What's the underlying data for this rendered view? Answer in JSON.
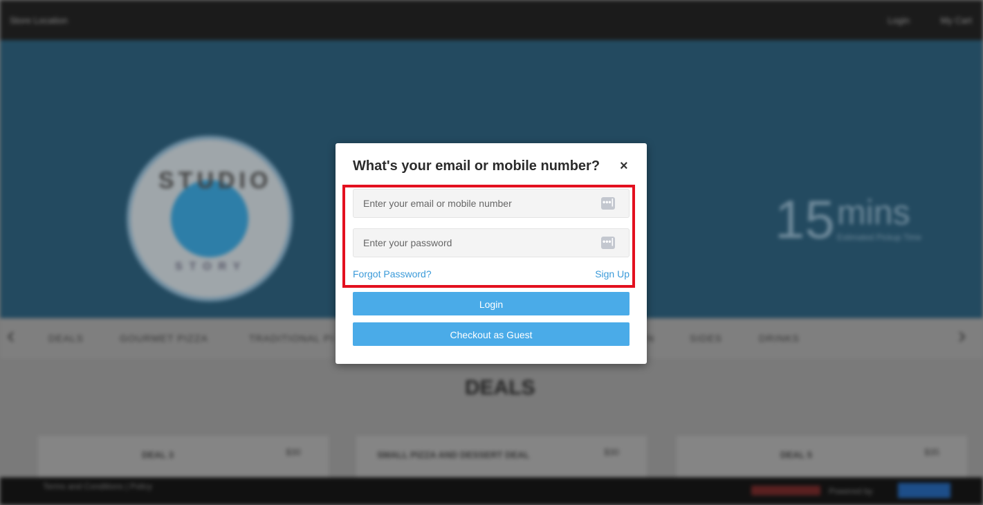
{
  "topbar": {
    "store_location": "Store Location",
    "login": "Login",
    "cart": "My Cart"
  },
  "hero": {
    "logo_top_text": "STUDIO",
    "logo_bottom_text": "STORY",
    "timer_number": "15",
    "timer_unit": "mins",
    "timer_caption": "Estimated Pickup Time"
  },
  "categories": {
    "items": [
      "DEALS",
      "GOURMET PIZZA",
      "TRADITIONAL PI",
      "N",
      "SIDES",
      "DRINKS"
    ],
    "prev_arrow": "‹",
    "next_arrow": "›"
  },
  "section": {
    "title": "DEALS",
    "cards": [
      {
        "name": "DEAL 3",
        "price": "$30"
      },
      {
        "name": "SMALL PIZZA AND DESSERT DEAL",
        "price": "$30"
      },
      {
        "name": "DEAL 5",
        "price": "$35"
      }
    ]
  },
  "footer": {
    "terms": "Terms and Conditions | Policy",
    "powered_by": "Powered by"
  },
  "modal": {
    "title": "What's your email or mobile number?",
    "close": "×",
    "email_placeholder": "Enter your email or mobile number",
    "password_placeholder": "Enter your password",
    "forgot_password": "Forgot Password?",
    "sign_up": "Sign Up",
    "login_button": "Login",
    "guest_button": "Checkout as Guest",
    "key_icon_glyph": "•••|",
    "highlight_color": "#e3101f",
    "button_color": "#4aabe8",
    "link_color": "#3a9ad9"
  }
}
